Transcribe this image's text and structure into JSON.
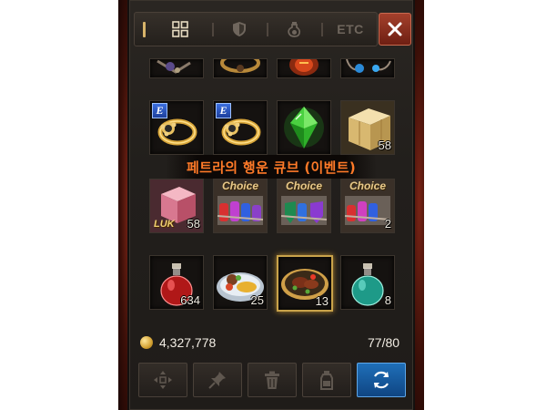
{
  "tabs": [
    {
      "id": "all",
      "icon": "grid-icon",
      "active": true
    },
    {
      "id": "equip",
      "icon": "shield-icon",
      "active": false
    },
    {
      "id": "consume",
      "icon": "potion-icon",
      "active": false
    },
    {
      "id": "etc",
      "label": "ETC",
      "active": false
    }
  ],
  "tooltip": "페트라의 행운 큐브 (이벤트)",
  "items": [
    {
      "slot": 1,
      "name": "amulet",
      "icon": "amulet-icon"
    },
    {
      "slot": 2,
      "name": "ring",
      "icon": "ring-icon"
    },
    {
      "slot": 3,
      "name": "red-jewel",
      "icon": "jewel-icon"
    },
    {
      "slot": 4,
      "name": "blue-necklace",
      "icon": "necklace-icon"
    },
    {
      "slot": 5,
      "name": "gold-ring",
      "icon": "ring-icon",
      "badge": "E"
    },
    {
      "slot": 6,
      "name": "gold-ring",
      "icon": "ring-icon",
      "badge": "E"
    },
    {
      "slot": 7,
      "name": "green-crystal",
      "icon": "crystal-icon"
    },
    {
      "slot": 8,
      "name": "gold-cube",
      "icon": "cube-icon",
      "quantity": "58"
    },
    {
      "slot": 9,
      "name": "luk-cube",
      "icon": "cube-icon",
      "label": "LUK",
      "quantity": "58"
    },
    {
      "slot": 10,
      "name": "choice-potion-box",
      "icon": "potion-box-icon",
      "label": "Choice"
    },
    {
      "slot": 11,
      "name": "choice-potion-box",
      "icon": "potion-box-icon",
      "label": "Choice"
    },
    {
      "slot": 12,
      "name": "choice-potion-box",
      "icon": "potion-box-icon",
      "label": "Choice",
      "quantity": "2"
    },
    {
      "slot": 13,
      "name": "red-potion",
      "icon": "potion-icon",
      "quantity": "634"
    },
    {
      "slot": 14,
      "name": "meal-plate",
      "icon": "food-icon",
      "quantity": "25"
    },
    {
      "slot": 15,
      "name": "steak-plate",
      "icon": "food-icon",
      "quantity": "13",
      "selected": true
    },
    {
      "slot": 16,
      "name": "green-potion",
      "icon": "potion-icon",
      "quantity": "8"
    }
  ],
  "gold": "4,327,778",
  "capacity": "77/80",
  "actions": [
    {
      "id": "move",
      "icon": "move-icon"
    },
    {
      "id": "pin",
      "icon": "pin-icon"
    },
    {
      "id": "trash",
      "icon": "trash-icon"
    },
    {
      "id": "sell",
      "icon": "bottle-icon"
    },
    {
      "id": "sort",
      "icon": "refresh-icon",
      "primary": true
    }
  ],
  "colors": {
    "tooltip_text": "#ff7a28",
    "selected_border": "#c9a34a",
    "primary_button": "#1f6fb8"
  }
}
